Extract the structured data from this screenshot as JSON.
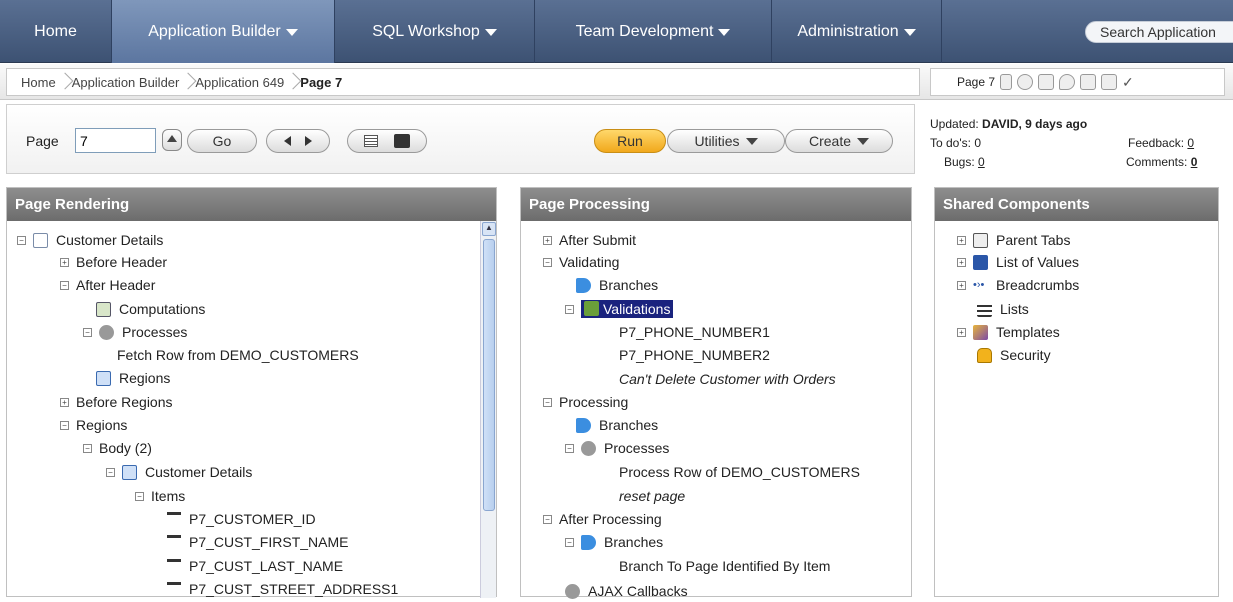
{
  "nav": {
    "tabs": [
      {
        "label": "Home"
      },
      {
        "label": "Application Builder"
      },
      {
        "label": "SQL Workshop"
      },
      {
        "label": "Team Development"
      },
      {
        "label": "Administration"
      }
    ],
    "search_label": "Search Application"
  },
  "breadcrumb": {
    "items": [
      "Home",
      "Application Builder",
      "Application 649",
      "Page 7"
    ]
  },
  "page_tools": {
    "label": "Page 7"
  },
  "controls": {
    "page_label": "Page",
    "page_value": "7",
    "go_label": "Go",
    "run_label": "Run",
    "utilities_label": "Utilities",
    "create_label": "Create"
  },
  "status": {
    "updated_label": "Updated:",
    "updated_value": "DAVID, 9 days ago",
    "todos_label": "To do's:",
    "todos_value": "0",
    "feedback_label": "Feedback:",
    "feedback_value": "0",
    "bugs_label": "Bugs:",
    "bugs_value": "0",
    "comments_label": "Comments:",
    "comments_value": "0"
  },
  "rendering": {
    "title": "Page Rendering",
    "nodes": [
      {
        "label": "Customer Details",
        "icon": "page-icon"
      },
      {
        "label": "Before Header"
      },
      {
        "label": "After Header"
      },
      {
        "label": "Computations",
        "icon": "calculator-icon"
      },
      {
        "label": "Processes",
        "icon": "gears-icon"
      },
      {
        "label": "Fetch Row from DEMO_CUSTOMERS"
      },
      {
        "label": "Regions",
        "icon": "region-icon"
      },
      {
        "label": "Before Regions"
      },
      {
        "label": "Regions"
      },
      {
        "label": "Body (2)"
      },
      {
        "label": "Customer Details",
        "icon": "region-icon"
      },
      {
        "label": "Items"
      },
      {
        "label": "P7_CUSTOMER_ID",
        "icon": "item-icon"
      },
      {
        "label": "P7_CUST_FIRST_NAME",
        "icon": "item-icon"
      },
      {
        "label": "P7_CUST_LAST_NAME",
        "icon": "item-icon"
      },
      {
        "label": "P7_CUST_STREET_ADDRESS1",
        "icon": "item-icon"
      }
    ]
  },
  "processing": {
    "title": "Page Processing",
    "nodes": [
      {
        "label": "After Submit"
      },
      {
        "label": "Validating"
      },
      {
        "label": "Branches",
        "icon": "arrow-icon"
      },
      {
        "label": "Validations",
        "icon": "validation-icon",
        "selected": true
      },
      {
        "label": "P7_PHONE_NUMBER1"
      },
      {
        "label": "P7_PHONE_NUMBER2"
      },
      {
        "label": "Can't Delete Customer with Orders"
      },
      {
        "label": "Processing"
      },
      {
        "label": "Branches",
        "icon": "arrow-icon"
      },
      {
        "label": "Processes",
        "icon": "gears-icon"
      },
      {
        "label": "Process Row of DEMO_CUSTOMERS"
      },
      {
        "label": "reset page"
      },
      {
        "label": "After Processing"
      },
      {
        "label": "Branches",
        "icon": "arrow-icon"
      },
      {
        "label": "Branch To Page Identified By Item"
      },
      {
        "label": "AJAX Callbacks",
        "icon": "gears-icon"
      }
    ]
  },
  "shared": {
    "title": "Shared Components",
    "nodes": [
      {
        "label": "Parent Tabs",
        "icon": "tabs-icon"
      },
      {
        "label": "List of Values",
        "icon": "lov-icon"
      },
      {
        "label": "Breadcrumbs",
        "icon": "breadcrumbs-icon"
      },
      {
        "label": "Lists",
        "icon": "list-icon"
      },
      {
        "label": "Templates",
        "icon": "templates-icon"
      },
      {
        "label": "Security",
        "icon": "lock-icon"
      }
    ]
  }
}
